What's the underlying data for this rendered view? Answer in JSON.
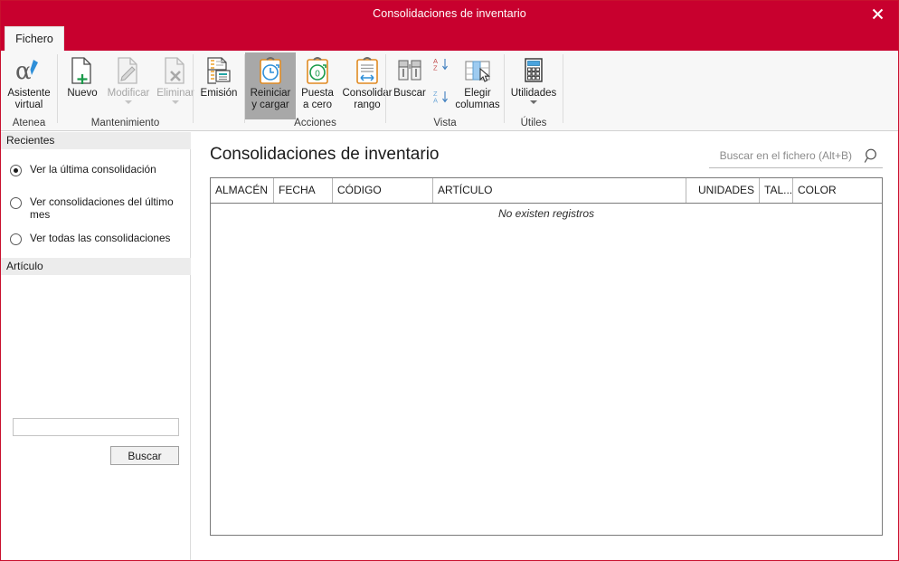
{
  "window": {
    "title": "Consolidaciones de inventario",
    "close_label": "close-icon",
    "accent_color": "#c8002e"
  },
  "tabs": [
    {
      "label": "Fichero",
      "active": true
    }
  ],
  "ribbon": {
    "groups": [
      {
        "label": "Atenea",
        "buttons": [
          {
            "label": "Asistente\nvirtual",
            "icon": "alpha-pen-icon",
            "state": "enabled"
          }
        ]
      },
      {
        "label": "Mantenimiento",
        "buttons": [
          {
            "label": "Nuevo",
            "icon": "new-document-icon",
            "state": "enabled"
          },
          {
            "label": "Modificar",
            "icon": "edit-document-icon",
            "state": "disabled",
            "dropdown": true
          },
          {
            "label": "Eliminar",
            "icon": "delete-document-icon",
            "state": "disabled",
            "dropdown": true
          }
        ]
      },
      {
        "label": "",
        "buttons": [
          {
            "label": "Emisión",
            "icon": "print-report-icon",
            "state": "enabled"
          }
        ]
      },
      {
        "label": "Acciones",
        "buttons": [
          {
            "label": "Reiniciar\ny cargar",
            "icon": "clipboard-clock-icon",
            "state": "highlighted"
          },
          {
            "label": "Puesta\na cero",
            "icon": "clipboard-zero-icon",
            "state": "enabled"
          },
          {
            "label": "Consolidar\nrango",
            "icon": "clipboard-range-icon",
            "state": "enabled"
          }
        ]
      },
      {
        "label": "Vista",
        "buttons": [
          {
            "label": "Buscar",
            "icon": "binoculars-icon",
            "state": "enabled"
          },
          {
            "label": "",
            "icon": "sort-az-icon",
            "state": "enabled"
          },
          {
            "label": "",
            "icon": "sort-za-icon",
            "state": "enabled"
          },
          {
            "label": "Elegir\ncolumnas",
            "icon": "choose-columns-icon",
            "state": "enabled"
          }
        ]
      },
      {
        "label": "Útiles",
        "buttons": [
          {
            "label": "Utilidades",
            "icon": "calculator-icon",
            "state": "enabled",
            "dropdown": true
          }
        ]
      }
    ]
  },
  "sidebar": {
    "sections": [
      {
        "header": "Recientes",
        "options": [
          {
            "label": "Ver la última consolidación",
            "selected": true
          },
          {
            "label": "Ver consolidaciones del último mes",
            "selected": false
          },
          {
            "label": "Ver todas las consolidaciones",
            "selected": false
          }
        ]
      },
      {
        "header": "Artículo",
        "input_value": "",
        "input_placeholder": "",
        "button_label": "Buscar"
      }
    ]
  },
  "main": {
    "title": "Consolidaciones de inventario",
    "search": {
      "value": "",
      "placeholder": "Buscar en el fichero (Alt+B)"
    },
    "table": {
      "columns": [
        {
          "key": "almacen",
          "label": "ALMACÉN",
          "align": "left"
        },
        {
          "key": "fecha",
          "label": "FECHA",
          "align": "left"
        },
        {
          "key": "codigo",
          "label": "CÓDIGO",
          "align": "left"
        },
        {
          "key": "articulo",
          "label": "ARTÍCULO",
          "align": "left"
        },
        {
          "key": "unidades",
          "label": "UNIDADES",
          "align": "right"
        },
        {
          "key": "talla",
          "label": "TAL...",
          "align": "left"
        },
        {
          "key": "color",
          "label": "COLOR",
          "align": "left"
        }
      ],
      "rows": [],
      "empty_message": "No existen registros"
    }
  }
}
